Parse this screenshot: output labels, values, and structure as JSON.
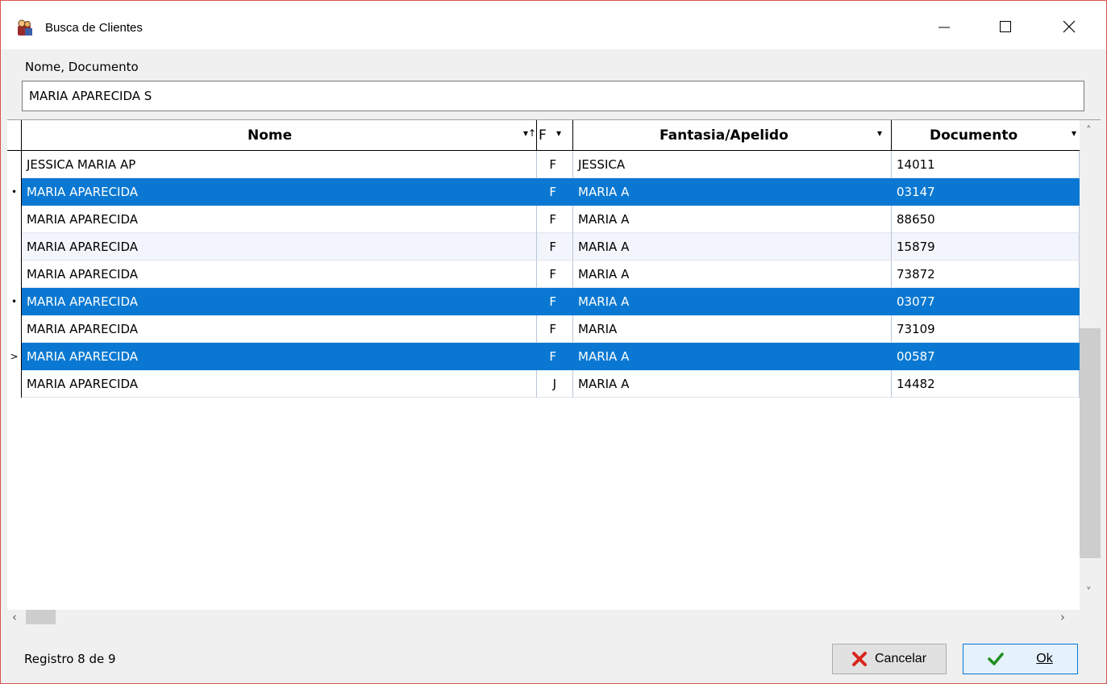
{
  "window": {
    "title": "Busca de Clientes"
  },
  "search": {
    "label": "Nome,  Documento",
    "value": "MARIA APARECIDA S"
  },
  "grid": {
    "headers": {
      "nome": "Nome",
      "f": "F",
      "fantasia": "Fantasia/Apelido",
      "documento": "Documento"
    },
    "rows": [
      {
        "nome": "JESSICA MARIA AP",
        "f": "F",
        "fantasia": "JESSICA",
        "documento": "14011",
        "state": "normal",
        "indicator": ""
      },
      {
        "nome": "MARIA APARECIDA",
        "f": "F",
        "fantasia": "MARIA A",
        "documento": "03147",
        "state": "selected",
        "indicator": "•"
      },
      {
        "nome": "MARIA APARECIDA",
        "f": "F",
        "fantasia": "MARIA A",
        "documento": "88650",
        "state": "normal",
        "indicator": ""
      },
      {
        "nome": "MARIA APARECIDA",
        "f": "F",
        "fantasia": "MARIA A",
        "documento": "15879",
        "state": "alt",
        "indicator": ""
      },
      {
        "nome": "MARIA APARECIDA",
        "f": "F",
        "fantasia": "MARIA A",
        "documento": "73872",
        "state": "normal",
        "indicator": ""
      },
      {
        "nome": "MARIA APARECIDA",
        "f": "F",
        "fantasia": "MARIA A",
        "documento": "03077",
        "state": "selected",
        "indicator": "•"
      },
      {
        "nome": "MARIA APARECIDA",
        "f": "F",
        "fantasia": "MARIA",
        "documento": "73109",
        "state": "normal",
        "indicator": ""
      },
      {
        "nome": "MARIA APARECIDA",
        "f": "F",
        "fantasia": "MARIA A",
        "documento": "00587",
        "state": "selected",
        "indicator": ">"
      },
      {
        "nome": "MARIA APARECIDA",
        "f": "J",
        "fantasia": "MARIA A",
        "documento": "14482",
        "state": "normal",
        "indicator": ""
      }
    ]
  },
  "status": {
    "text": "Registro 8 de 9"
  },
  "buttons": {
    "cancel": "Cancelar",
    "ok": "Ok"
  },
  "colors": {
    "selection": "#0a78d2",
    "window_border": "#d9534f",
    "cancel_icon": "#d9251d",
    "ok_icon": "#1e8f1e"
  }
}
